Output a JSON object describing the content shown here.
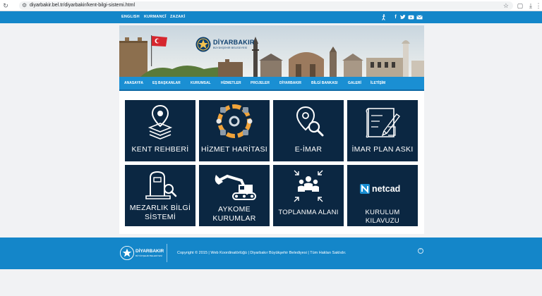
{
  "browser": {
    "url": "diyarbakir.bel.tr/diyarbakir/kent-bilgi-sistemi.html"
  },
  "top_links": [
    "ENGLISH",
    "KURMANCÎ",
    "ZAZAKİ"
  ],
  "social_icons": [
    "accessibility-icon",
    "facebook-icon",
    "twitter-icon",
    "youtube-icon",
    "mail-icon"
  ],
  "logo": {
    "title": "DİYARBAKIR",
    "subtitle": "BÜYÜKŞEHİR BELEDİYESİ"
  },
  "menu": [
    "ANASAYFA",
    "EŞ BAŞKANLAR",
    "KURUMSAL",
    "HİZMETLER",
    "PROJELER",
    "DİYARBAKIR",
    "BİLGİ BANKASI",
    "GALERİ",
    "İLETİŞİM"
  ],
  "tiles": [
    {
      "icon": "map-pin-layers-icon",
      "label": [
        "KENT REHBERİ"
      ]
    },
    {
      "icon": "service-gears-icon",
      "label": [
        "HİZMET HARİTASI"
      ]
    },
    {
      "icon": "map-search-icon",
      "label": [
        "E-İMAR"
      ]
    },
    {
      "icon": "plan-drawing-icon",
      "label": [
        "İMAR PLAN ASKI"
      ]
    },
    {
      "icon": "grave-search-icon",
      "label": [
        "MEZARLIK BİLGİ",
        "SİSTEMİ"
      ]
    },
    {
      "icon": "excavator-icon",
      "label": [
        "AYKOME",
        "KURUMLAR"
      ]
    },
    {
      "icon": "gathering-icon",
      "label": [
        "TOPLANMA ALANI"
      ]
    },
    {
      "icon": "netcad-logo",
      "brand": "netcad",
      "label": [
        "KURULUM KILAVUZU"
      ]
    }
  ],
  "footer": {
    "logo_title": "DİYARBAKIR",
    "logo_subtitle": "BÜYÜKŞEHİR BELEDİYESİ",
    "copyright": "Copyright © 2015 | Web Koordinatörlüğü | Diyarbakır Büyükşehir Belediyesi | Tüm Hakları Saklıdır."
  },
  "colors": {
    "brand_blue": "#1486c9",
    "menu_blue": "#1a8fd3",
    "tile_navy": "#0b2742",
    "accent_orange": "#f0a33a"
  }
}
